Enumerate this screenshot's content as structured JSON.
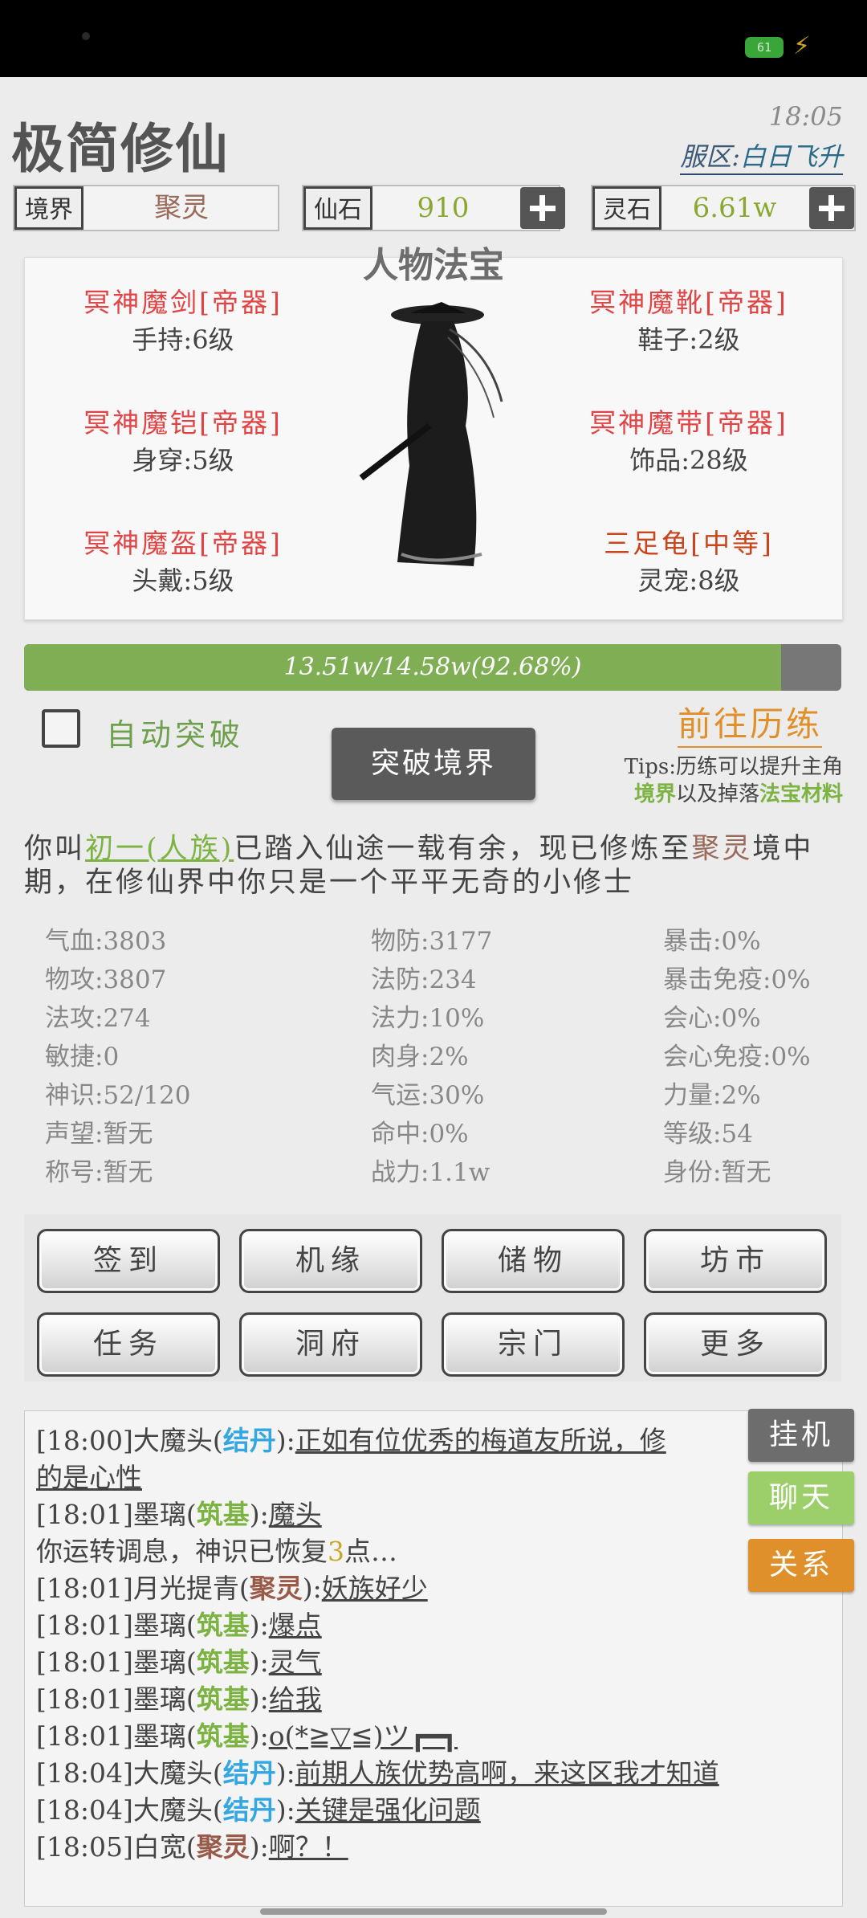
{
  "status_bar": {
    "battery": "61"
  },
  "header": {
    "app_title": "极简修仙",
    "clock": "18:05",
    "server_label": "服区:",
    "server_name": "白日飞升"
  },
  "resources": {
    "realm_label": "境界",
    "realm_value": "聚灵",
    "xianshi_label": "仙石",
    "xianshi_value": "910",
    "lingshi_label": "灵石",
    "lingshi_value": "6.61w"
  },
  "equipment": {
    "title": "人物法宝",
    "left": [
      {
        "name": "冥神魔剑[帝器]",
        "detail": "手持:6级"
      },
      {
        "name": "冥神魔铠[帝器]",
        "detail": "身穿:5级"
      },
      {
        "name": "冥神魔盔[帝器]",
        "detail": "头戴:5级"
      }
    ],
    "right": [
      {
        "name": "冥神魔靴[帝器]",
        "detail": "鞋子:2级"
      },
      {
        "name": "冥神魔带[帝器]",
        "detail": "饰品:28级"
      },
      {
        "name": "三足龟[中等]",
        "detail": "灵宠:8级"
      }
    ]
  },
  "progress": {
    "text": "13.51w/14.58w(92.68%)",
    "percent": 92.68
  },
  "actions": {
    "auto_breakthrough": "自动突破",
    "auto_checked": false,
    "breakthrough_button": "突破境界",
    "go_train": "前往历练",
    "tips_line1": "Tips:历练可以提升主角",
    "tips_g1": "境界",
    "tips_mid": "以及掉落",
    "tips_g2": "法宝材料"
  },
  "intro": {
    "p1": "你叫",
    "name": "初一(人族)",
    "p2": "已踏入仙途一载有余，现已修炼至",
    "realm": "聚灵",
    "p3": "境中期，在修仙界中你只是一个平平无奇的小修士"
  },
  "stats": {
    "col1": [
      "气血:3803",
      "物攻:3807",
      "法攻:274",
      "敏捷:0",
      "神识:52/120",
      "声望:暂无",
      "称号:暂无"
    ],
    "col2": [
      "物防:3177",
      "法防:234",
      "法力:10%",
      "肉身:2%",
      "气运:30%",
      "命中:0%",
      "战力:1.1w"
    ],
    "col3": [
      "暴击:0%",
      "暴击免疫:0%",
      "会心:0%",
      "会心免疫:0%",
      "力量:2%",
      "等级:54",
      "身份:暂无"
    ]
  },
  "menu": [
    "签到",
    "机缘",
    "储物",
    "坊市",
    "任务",
    "洞府",
    "宗门",
    "更多"
  ],
  "chat": [
    {
      "time": "[18:00]",
      "user": "大魔头",
      "realm": "结丹",
      "realm_color": "blue",
      "msg": "正如有位优秀的梅道友所说，修"
    },
    {
      "cont": "的是心性"
    },
    {
      "time": "[18:01]",
      "user": "墨璃",
      "realm": "筑基",
      "realm_color": "green",
      "msg": "魔头"
    },
    {
      "system": "你运转调息，神识已恢复",
      "system_num": "3",
      "system_end": "点…"
    },
    {
      "time": "[18:01]",
      "user": "月光提青",
      "realm": "聚灵",
      "realm_color": "brown",
      "msg": "妖族好少"
    },
    {
      "time": "[18:01]",
      "user": "墨璃",
      "realm": "筑基",
      "realm_color": "green",
      "msg": "爆点"
    },
    {
      "time": "[18:01]",
      "user": "墨璃",
      "realm": "筑基",
      "realm_color": "green",
      "msg": "灵气"
    },
    {
      "time": "[18:01]",
      "user": "墨璃",
      "realm": "筑基",
      "realm_color": "green",
      "msg": "给我"
    },
    {
      "time": "[18:01]",
      "user": "墨璃",
      "realm": "筑基",
      "realm_color": "green",
      "msg": "o(*≧▽≦)ツ┏━┓"
    },
    {
      "time": "[18:04]",
      "user": "大魔头",
      "realm": "结丹",
      "realm_color": "blue",
      "msg": "前期人族优势高啊，来这区我才知道"
    },
    {
      "time": "[18:04]",
      "user": "大魔头",
      "realm": "结丹",
      "realm_color": "blue",
      "msg": "关键是强化问题"
    },
    {
      "time": "[18:05]",
      "user": "白宽",
      "realm": "聚灵",
      "realm_color": "brown",
      "msg": "啊？！"
    }
  ],
  "side_buttons": [
    {
      "label": "挂机",
      "color": "#6d6d6d"
    },
    {
      "label": "聊天",
      "color": "#9ccf6a"
    },
    {
      "label": "关系",
      "color": "#e0902a"
    }
  ]
}
